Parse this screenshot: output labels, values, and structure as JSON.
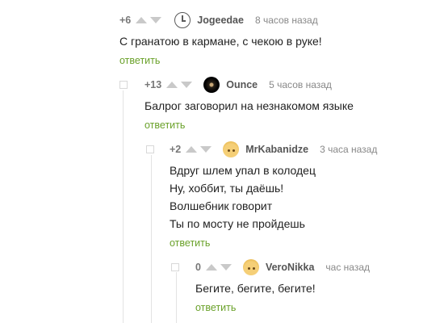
{
  "comments": [
    {
      "rating": "+6",
      "username": "Jogeedae",
      "time": "8 часов назад",
      "avatar": "clock-icon",
      "lines": [
        "С гранатою в кармане, с чекою в руке!"
      ],
      "reply": "ответить"
    },
    {
      "rating": "+13",
      "username": "Ounce",
      "time": "5 часов назад",
      "avatar": "dark-round-avatar",
      "lines": [
        "Балрог заговорил на незнакомом языке"
      ],
      "reply": "ответить"
    },
    {
      "rating": "+2",
      "username": "MrKabanidze",
      "time": "3 часа назад",
      "avatar": "bunny-avatar",
      "lines": [
        "Вдруг шлем упал в колодец",
        "Ну, хоббит, ты даёшь!",
        "Волшебник говорит",
        "Ты по мосту не пройдешь"
      ],
      "reply": "ответить"
    },
    {
      "rating": "0",
      "username": "VeroNikka",
      "time": "час назад",
      "avatar": "bunny-avatar",
      "lines": [
        "Бегите, бегите, бегите!"
      ],
      "reply": "ответить"
    }
  ],
  "colors": {
    "reply_link": "#6aa12a",
    "arrow": "#c9c9c9",
    "thread_line": "#e3e3e3"
  }
}
